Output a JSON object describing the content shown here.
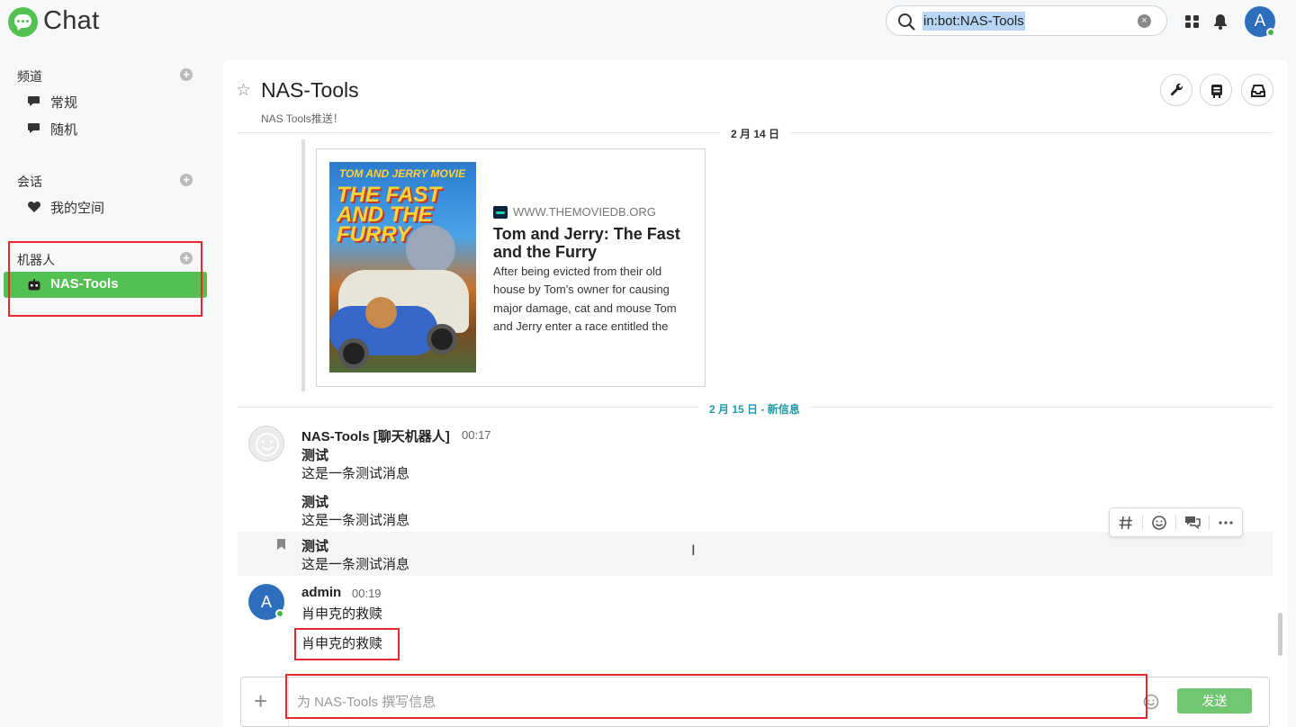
{
  "app": {
    "title": "Chat"
  },
  "search": {
    "value": "in:bot:NAS-Tools",
    "clear_label": "×"
  },
  "user": {
    "initial": "A"
  },
  "sidebar": {
    "channels_title": "频道",
    "channels": [
      {
        "label": "常规"
      },
      {
        "label": "随机"
      }
    ],
    "conversations_title": "会话",
    "conversations": [
      {
        "label": "我的空间"
      }
    ],
    "bots_title": "机器人",
    "bots": [
      {
        "label": "NAS-Tools",
        "active": true
      }
    ],
    "add_label": "+"
  },
  "channel": {
    "star": "☆",
    "title": "NAS-Tools",
    "description": "NAS Tools推送！"
  },
  "dates": {
    "first": "2 月 14 日",
    "second": "2 月 15 日 - 新信息"
  },
  "embed": {
    "poster_top": "TOM AND JERRY MOVIE",
    "poster_title": "THE FAST AND THE FURRY",
    "site": "WWW.THEMOVIEDB.ORG",
    "title": "Tom and Jerry: The Fast and the Furry",
    "description": "After being evicted from their old house by Tom's owner for causing major damage, cat and mouse Tom and Jerry enter a race entitled the"
  },
  "messages": {
    "bot": {
      "sender": "NAS-Tools [聊天机器人]",
      "time": "00:17",
      "items": [
        {
          "title": "测试",
          "body": "这是一条测试消息"
        },
        {
          "title": "测试",
          "body": "这是一条测试消息"
        },
        {
          "title": "测试",
          "body": "这是一条测试消息"
        }
      ]
    },
    "admin": {
      "initial": "A",
      "sender": "admin",
      "time": "00:19",
      "items": [
        {
          "body": "肖申克的救赎"
        },
        {
          "body": "肖申克的救赎"
        }
      ]
    }
  },
  "composer": {
    "plus_label": "+",
    "placeholder": "为 NAS-Tools 撰写信息",
    "send_label": "发送"
  },
  "colors": {
    "brand_green": "#52c152",
    "highlight_red": "#e8262b",
    "avatar_blue": "#2d6fbd",
    "new_marker": "#1e9aa8"
  }
}
